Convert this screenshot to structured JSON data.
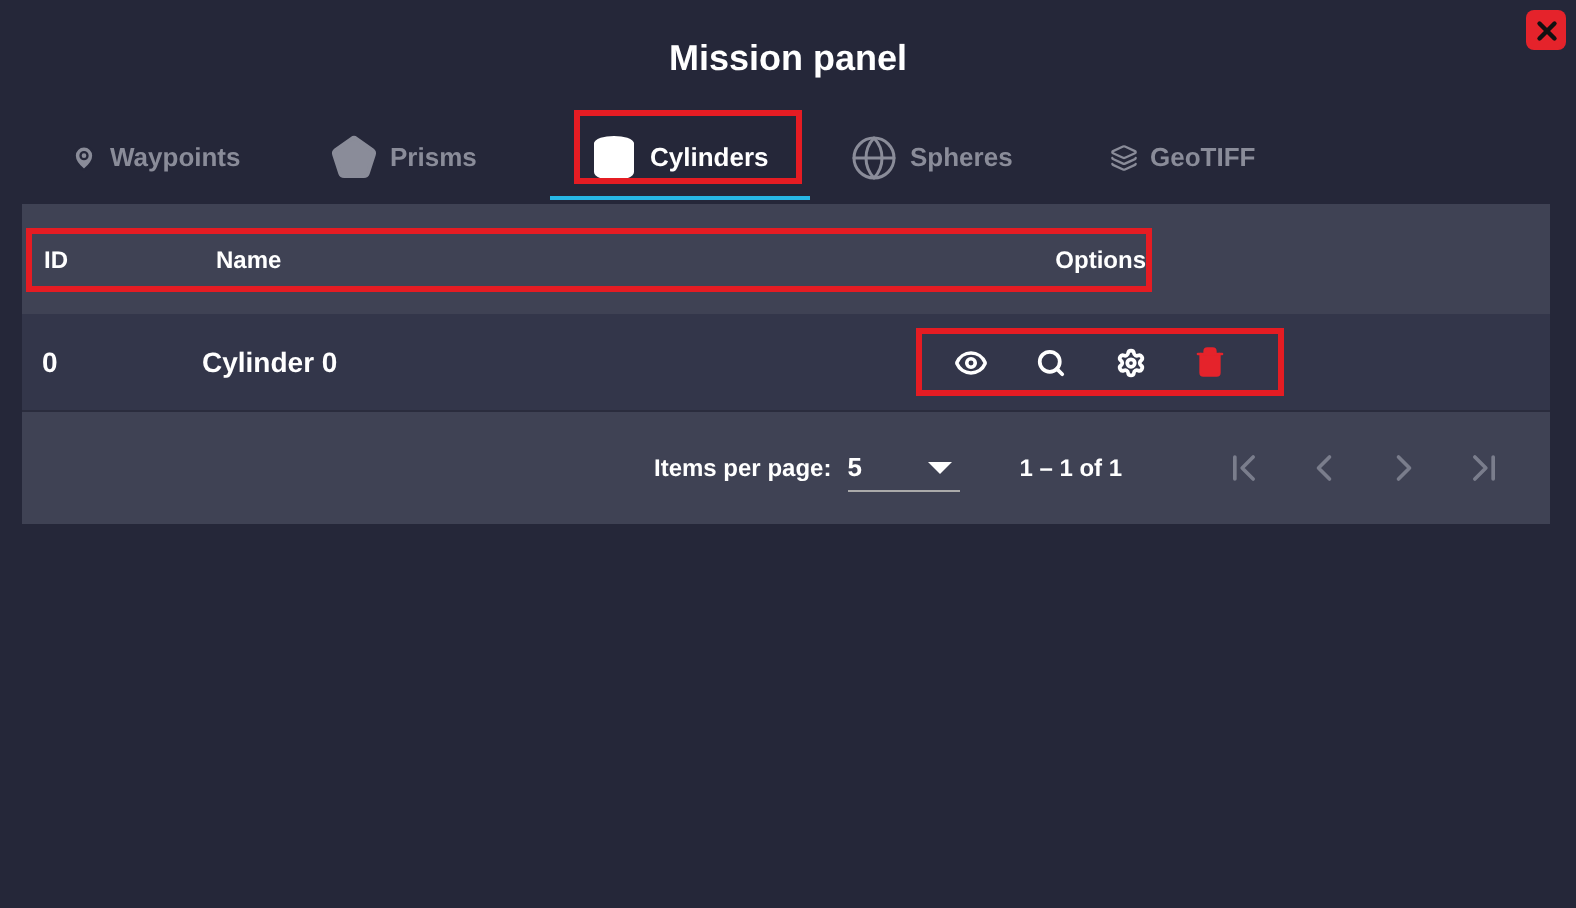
{
  "window": {
    "title": "Mission panel"
  },
  "tabs": [
    {
      "label": "Waypoints",
      "kind": "waypoint",
      "selected": false,
      "highlighted": false
    },
    {
      "label": "Prisms",
      "kind": "prism",
      "selected": false,
      "highlighted": false
    },
    {
      "label": "Cylinders",
      "kind": "cylinder",
      "selected": true,
      "highlighted": true
    },
    {
      "label": "Spheres",
      "kind": "sphere",
      "selected": false,
      "highlighted": false
    },
    {
      "label": "GeoTIFF",
      "kind": "geotiff",
      "selected": false,
      "highlighted": false
    }
  ],
  "table": {
    "columns": [
      "ID",
      "Name",
      "Options"
    ],
    "header_highlighted": true,
    "rows": [
      {
        "id": "0",
        "name": "Cylinder 0",
        "options_highlighted": true,
        "actions": [
          {
            "kind": "view"
          },
          {
            "kind": "zoom"
          },
          {
            "kind": "settings"
          },
          {
            "kind": "delete"
          }
        ]
      }
    ]
  },
  "paginator": {
    "items_per_page_label": "Items per page:",
    "page_size": "5",
    "range": "1 – 1 of 1",
    "nav": [
      {
        "kind": "first",
        "disabled": true
      },
      {
        "kind": "previous",
        "disabled": true
      },
      {
        "kind": "next",
        "disabled": true
      },
      {
        "kind": "last",
        "disabled": true
      }
    ]
  }
}
